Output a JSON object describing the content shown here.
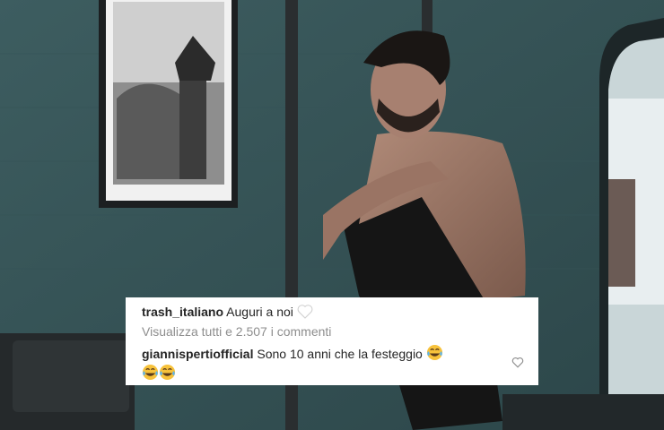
{
  "comments": [
    {
      "username": "trash_italiano",
      "text": "Auguri a noi",
      "emoji": "white-heart-icon"
    },
    {
      "username": "giannispertiofficial",
      "text": "Sono 10 anni che la festeggio",
      "emoji": "tears-of-joy-icon"
    }
  ],
  "view_all": "Visualizza tutti e 2.507 i commenti",
  "like_icon": "heart-outline-icon",
  "colors": {
    "text": "#262626",
    "muted": "#8e8e8e",
    "card": "#ffffff"
  }
}
